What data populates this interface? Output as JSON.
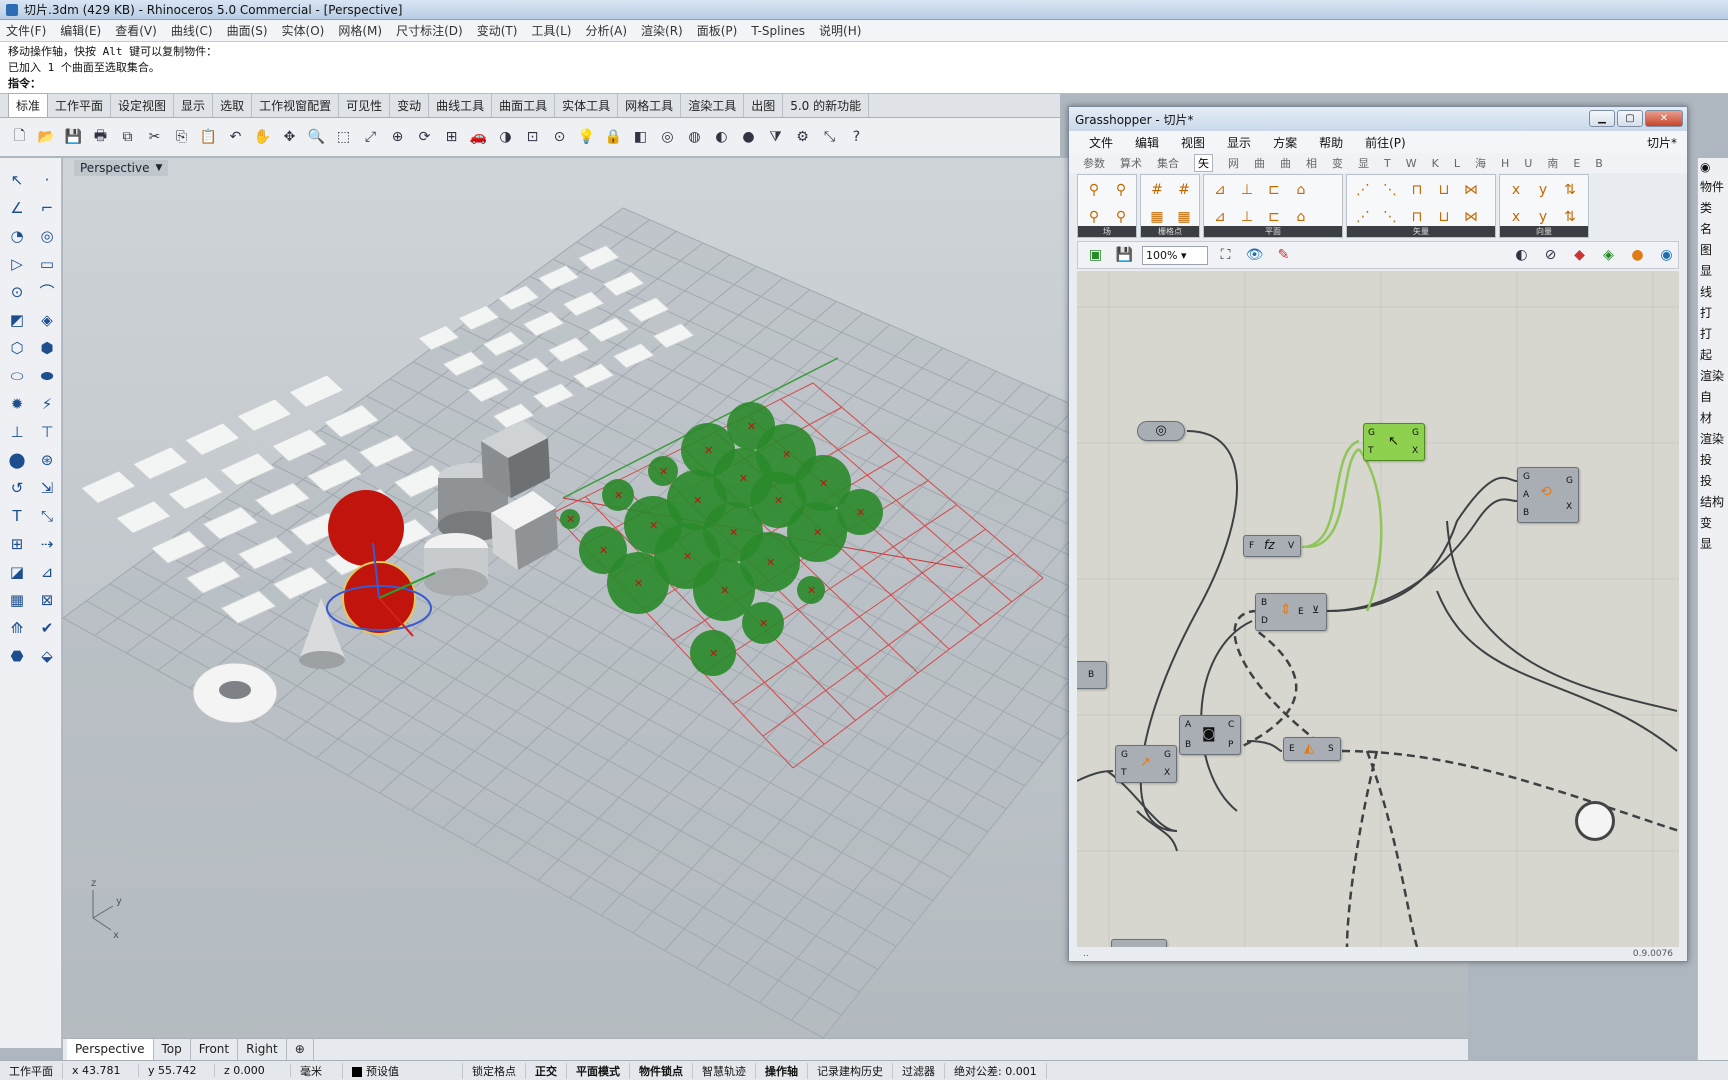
{
  "window": {
    "title": "切片.3dm (429 KB) - Rhinoceros 5.0 Commercial - [Perspective]"
  },
  "menu": [
    "文件(F)",
    "编辑(E)",
    "查看(V)",
    "曲线(C)",
    "曲面(S)",
    "实体(O)",
    "网格(M)",
    "尺寸标注(D)",
    "变动(T)",
    "工具(L)",
    "分析(A)",
    "渲染(R)",
    "面板(P)",
    "T-Splines",
    "说明(H)"
  ],
  "command": {
    "line1": "移动操作轴，快按 Alt 键可以复制物件：",
    "line2": "已加入 1 个曲面至选取集合。",
    "prompt": "指令："
  },
  "toolbar_tabs": [
    "标准",
    "工作平面",
    "设定视图",
    "显示",
    "选取",
    "工作视窗配置",
    "可见性",
    "变动",
    "曲线工具",
    "曲面工具",
    "实体工具",
    "网格工具",
    "渲染工具",
    "出图",
    "5.0 的新功能"
  ],
  "toolbar_icons": [
    "new-file-icon",
    "open-icon",
    "save-icon",
    "print-icon",
    "import-icon",
    "cut-icon",
    "copy-icon",
    "paste-icon",
    "undo-icon",
    "pan-icon",
    "move-icon",
    "zoom-icon",
    "zoom-window-icon",
    "zoom-extents-icon",
    "zoom-selected-icon",
    "rotate-view-icon",
    "four-views-icon",
    "car-icon",
    "shade-icon",
    "grid-icon",
    "point-icon",
    "light-icon",
    "lock-icon",
    "layers-icon",
    "color-wheel-icon",
    "render-icon",
    "material-icon",
    "sphere-icon",
    "filter-icon",
    "settings-icon",
    "transform-icon",
    "help-icon"
  ],
  "viewport": {
    "label": "Perspective",
    "axes": {
      "x": "x",
      "y": "y",
      "z": "z"
    }
  },
  "viewport_tabs": [
    "Perspective",
    "Top",
    "Front",
    "Right"
  ],
  "status": {
    "cplane": "工作平面",
    "x": "x 43.781",
    "y": "y 55.742",
    "z": "z 0.000",
    "unit": "毫米",
    "layer": "预设值",
    "items": [
      "锁定格点",
      "正交",
      "平面模式",
      "物件锁点",
      "智慧轨迹",
      "操作轴",
      "记录建构历史",
      "过滤器"
    ],
    "bold_items": [
      "正交",
      "平面模式",
      "物件锁点",
      "操作轴"
    ],
    "tolerance": "绝对公差: 0.001"
  },
  "right_panel": {
    "items": [
      "物件",
      "类",
      "名",
      "图",
      "显",
      "线",
      "打",
      "打",
      "起",
      "渲染",
      "自",
      "材",
      "渲染",
      "投",
      "投",
      "结构",
      "变",
      "显"
    ]
  },
  "grasshopper": {
    "title": "Grasshopper - 切片*",
    "menu": [
      "文件",
      "编辑",
      "视图",
      "显示",
      "方案",
      "帮助",
      "前往(P)"
    ],
    "doc_tab": "切片*",
    "tabs": [
      "参数",
      "算术",
      "集合",
      "矢",
      "网",
      "曲",
      "曲",
      "相",
      "变",
      "显",
      "T",
      "W",
      "K",
      "L",
      "海",
      "H",
      "U",
      "南",
      "E",
      "B"
    ],
    "active_tab": "矢",
    "groups": [
      "场",
      "栅格点",
      "平面",
      "矢量",
      "向量"
    ],
    "zoom": "100%",
    "version": "0.9.0076",
    "status_left": "..",
    "components": {
      "spiral": {
        "label": "spiral"
      },
      "green": {
        "in": [
          "G",
          "T"
        ],
        "out": [
          "G",
          "X"
        ]
      },
      "fz": {
        "in": [
          "F"
        ],
        "out": [
          "V"
        ]
      },
      "bd": {
        "in": [
          "B",
          "D"
        ],
        "mid": "E"
      },
      "gab": {
        "in": [
          "G",
          "A",
          "B"
        ],
        "out": [
          "G",
          "X"
        ]
      },
      "b_left": {
        "label": "B"
      },
      "abcp": {
        "in": [
          "A",
          "B"
        ],
        "out": [
          "C",
          "P"
        ]
      },
      "gtgx": {
        "in": [
          "G",
          "T"
        ],
        "out": [
          "G",
          "X"
        ]
      },
      "es": {
        "in": [
          "E"
        ],
        "out": [
          "S"
        ]
      }
    }
  },
  "colors": {
    "accent": "#1d4f8f",
    "selected_component": "#8ed14f",
    "red_object": "#c0140c",
    "green_discs": "#2a8a2a"
  }
}
